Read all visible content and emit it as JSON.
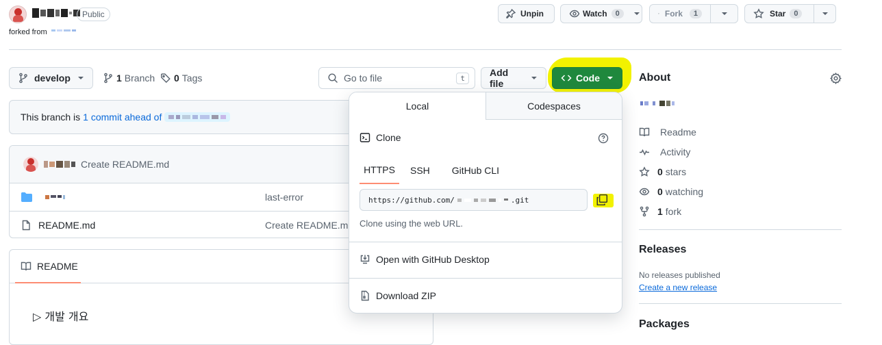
{
  "repo": {
    "visibility": "Public",
    "forked_from_label": "forked from"
  },
  "header_actions": {
    "unpin": "Unpin",
    "watch": "Watch",
    "watch_count": "0",
    "fork": "Fork",
    "fork_count": "1",
    "star": "Star",
    "star_count": "0"
  },
  "toolbar": {
    "branch": "develop",
    "branches_count": "1",
    "branches_label": "Branch",
    "tags_count": "0",
    "tags_label": "Tags",
    "search_placeholder": "Go to file",
    "search_key": "t",
    "add_file": "Add file",
    "code": "Code"
  },
  "branch_status": {
    "prefix": "This branch is",
    "link": "1 commit ahead of"
  },
  "commit": {
    "message": "Create README.md"
  },
  "files": [
    {
      "type": "folder",
      "name": "",
      "commit_msg": "last-error"
    },
    {
      "type": "file",
      "name": "README.md",
      "commit_msg": "Create README.md"
    }
  ],
  "readme": {
    "tab": "README",
    "summary": "▷ 개발 개요"
  },
  "code_dropdown": {
    "tabs": [
      "Local",
      "Codespaces"
    ],
    "clone_label": "Clone",
    "protocols": [
      "HTTPS",
      "SSH",
      "GitHub CLI"
    ],
    "url_prefix": "https://github.com/",
    "url_suffix": ".git",
    "hint": "Clone using the web URL.",
    "open_desktop": "Open with GitHub Desktop",
    "download_zip": "Download ZIP"
  },
  "about": {
    "title": "About",
    "items": [
      {
        "icon": "book-icon",
        "count": "",
        "label": "Readme"
      },
      {
        "icon": "pulse-icon",
        "count": "",
        "label": "Activity"
      },
      {
        "icon": "star-icon",
        "count": "0",
        "label": "stars"
      },
      {
        "icon": "eye-icon",
        "count": "0",
        "label": "watching"
      },
      {
        "icon": "fork-icon",
        "count": "1",
        "label": "fork"
      }
    ]
  },
  "releases": {
    "title": "Releases",
    "empty": "No releases published",
    "create_link": "Create a new release"
  },
  "packages": {
    "title": "Packages"
  },
  "colors": {
    "accent_green": "#1f883d",
    "highlight": "#f2f200",
    "link": "#0969da",
    "active_tab": "#fd8c73"
  }
}
